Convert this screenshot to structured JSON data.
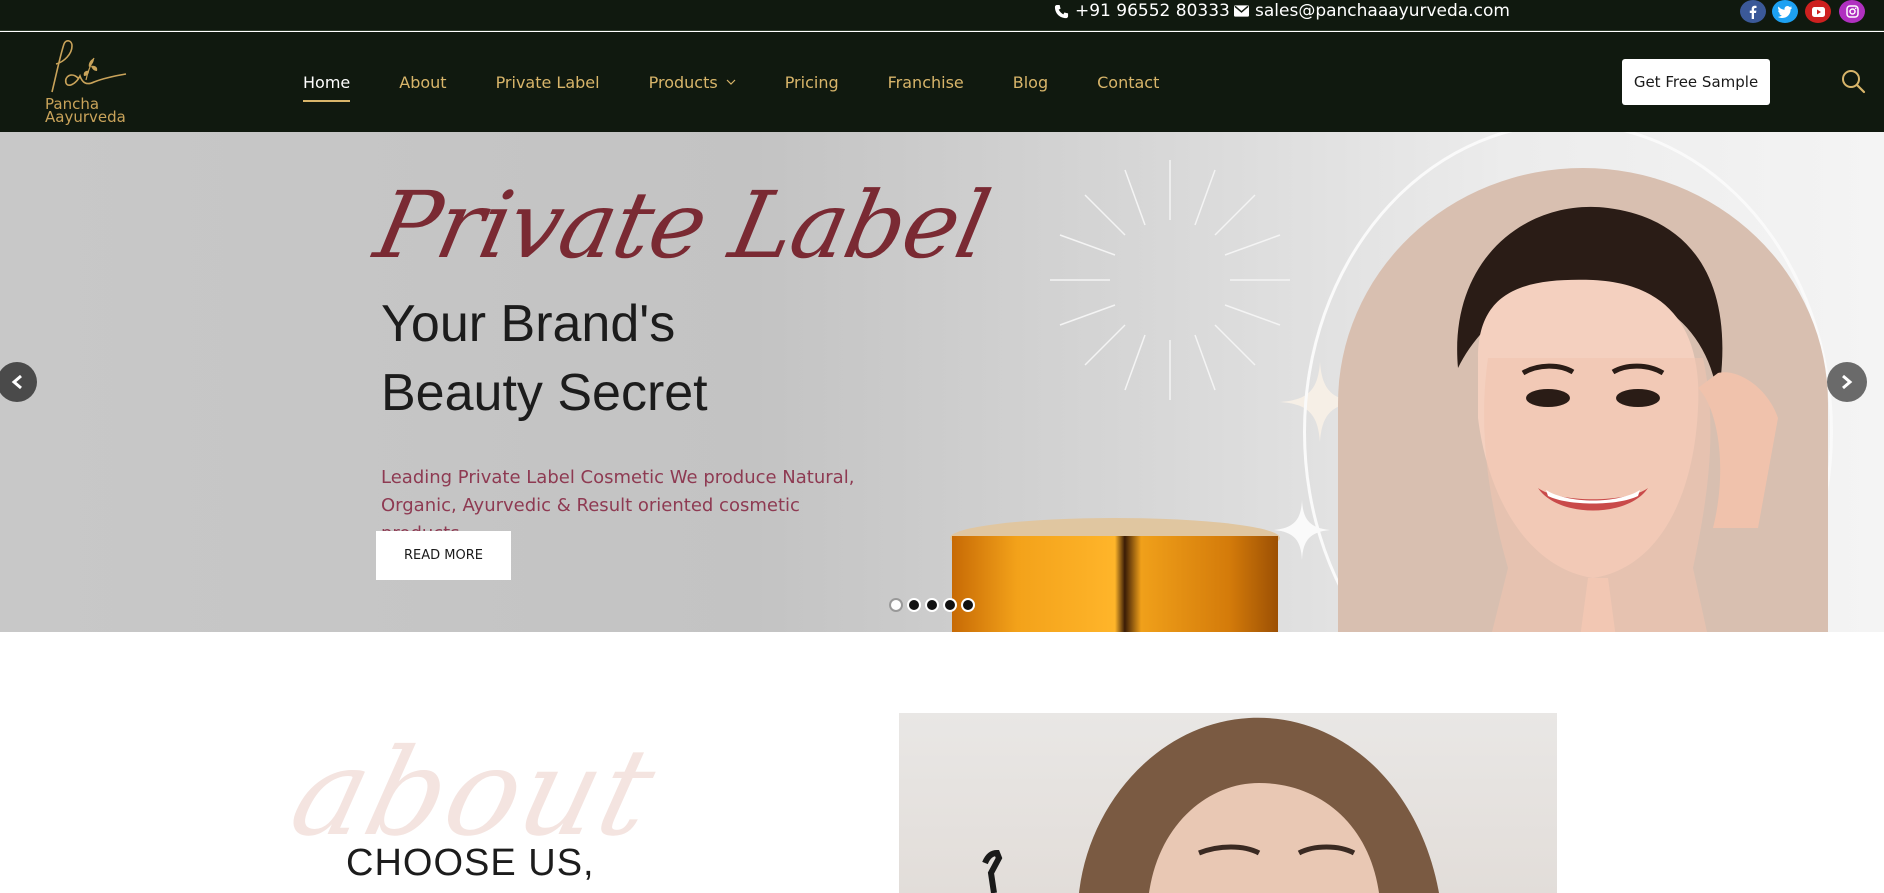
{
  "topbar": {
    "phone": "+91 96552 80333",
    "email": "sales@panchaaayurveda.com",
    "social": [
      {
        "name": "facebook-icon",
        "color": "#3b5998"
      },
      {
        "name": "twitter-icon",
        "color": "#1da1f2"
      },
      {
        "name": "youtube-icon",
        "color": "#cd201f"
      },
      {
        "name": "instagram-icon",
        "color": "#b030c0"
      }
    ]
  },
  "header": {
    "logo_text_1": "Pancha",
    "logo_text_2": "Aayurveda",
    "nav": [
      {
        "label": "Home",
        "active": true
      },
      {
        "label": "About"
      },
      {
        "label": "Private Label"
      },
      {
        "label": "Products",
        "has_dropdown": true
      },
      {
        "label": "Pricing"
      },
      {
        "label": "Franchise"
      },
      {
        "label": "Blog"
      },
      {
        "label": "Contact"
      }
    ],
    "cta_label": "Get Free Sample",
    "search_icon": "search-icon"
  },
  "hero": {
    "script_title": "Private Label",
    "title_line1": "Your Brand's",
    "title_line2": "Beauty Secret",
    "description": "Leading Private Label Cosmetic We produce Natural, Organic, Ayurvedic & Result oriented cosmetic products.",
    "button_label": "READ MORE",
    "slides_count": 5,
    "active_slide": 1
  },
  "about": {
    "script_text": "about",
    "heading": "CHOOSE US,"
  },
  "colors": {
    "header_bg": "#10190f",
    "nav_gold": "#d8b56a",
    "script_red": "#7a2a33",
    "desc_pink": "#8e3a52"
  }
}
